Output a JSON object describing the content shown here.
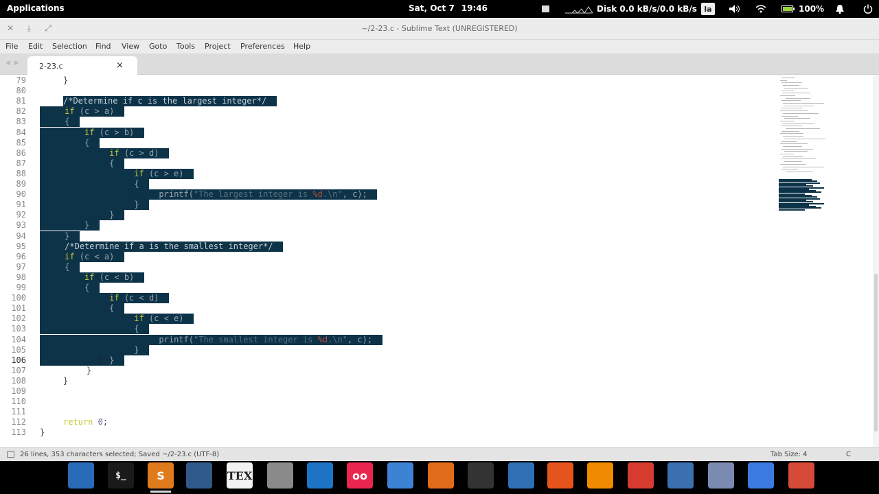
{
  "top_panel": {
    "applications": "Applications",
    "date": "Sat, Oct 7",
    "time": "19:46",
    "disk": "Disk 0.0 kB/s/0.0 kB/s",
    "keyboard": "la",
    "battery": "100%",
    "icons": [
      "screen-icon",
      "network-graph-icon",
      "volume-icon",
      "wifi-icon",
      "battery-icon",
      "notification-icon",
      "power-icon"
    ]
  },
  "window": {
    "title": "~/2-23.c - Sublime Text (UNREGISTERED)"
  },
  "menu": [
    "File",
    "Edit",
    "Selection",
    "Find",
    "View",
    "Goto",
    "Tools",
    "Project",
    "Preferences",
    "Help"
  ],
  "tab": {
    "name": "2-23.c",
    "close": "×"
  },
  "editor": {
    "line_numbers": [
      "79",
      "80",
      "81",
      "82",
      "83",
      "84",
      "85",
      "86",
      "87",
      "88",
      "89",
      "90",
      "91",
      "92",
      "93",
      "94",
      "95",
      "96",
      "97",
      "98",
      "99",
      "100",
      "101",
      "102",
      "103",
      "104",
      "105",
      "106",
      "107",
      "108",
      "109",
      "110",
      "111",
      "112",
      "113"
    ],
    "lines": [
      "}",
      "",
      "/*Determine if c is the largest integer*/",
      "if (c > a)",
      "{",
      "if (c > b)",
      "{",
      "if (c > d)",
      "{",
      "if (c > e)",
      "{",
      "printf(\"The largest integer is %d.\\n\", c);",
      "}",
      "}",
      "}",
      "}",
      "/*Determine if a is the smallest integer*/",
      "if (c < a)",
      "{",
      "if (c < b)",
      "{",
      "if (c < d)",
      "{",
      "if (c < e)",
      "{",
      "printf(\"The smallest integer is %d.\\n\", c);",
      "}",
      "}",
      "}",
      "}",
      "",
      "",
      "",
      "return 0;",
      "}"
    ]
  },
  "status": {
    "text": "26 lines, 353 characters selected; Saved ~/2-23.c (UTF-8)",
    "tab_size": "Tab Size: 4",
    "syntax": "C"
  },
  "dock": {
    "icons": [
      "workspaces-icon",
      "terminal-icon",
      "sublime-text-icon",
      "virtualbox-icon",
      "texmaker-icon",
      "file-manager-icon",
      "refresh-app-icon",
      "flickr-icon",
      "toggle-settings-icon",
      "burp-icon",
      "microphone-icon",
      "document-viewer-icon",
      "firefox-icon",
      "vlc-icon",
      "kde-app-icon",
      "tools-icon",
      "store-icon",
      "chromium-icon",
      "chrome-icon"
    ],
    "tex_label": "TEX"
  }
}
